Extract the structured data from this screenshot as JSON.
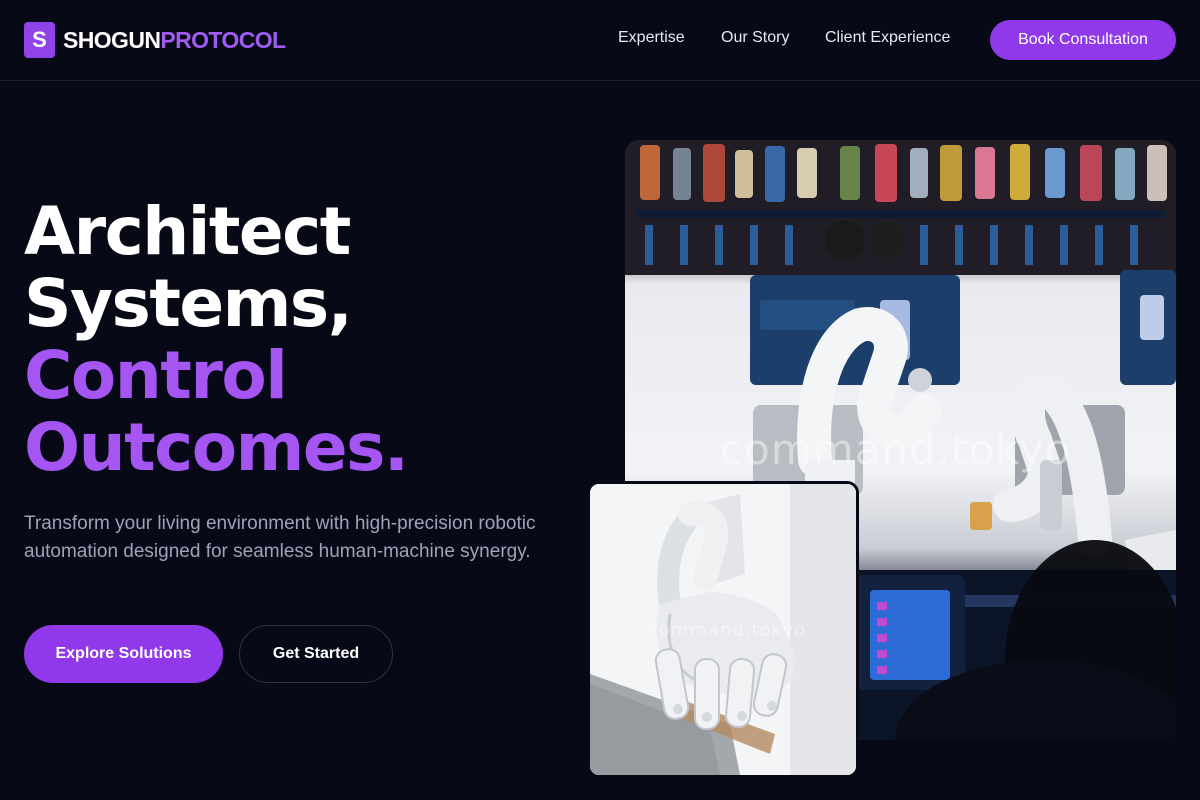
{
  "brand": {
    "mark": "S",
    "name_primary": "SHOGUN",
    "name_accent": "PROTOCOL"
  },
  "nav": {
    "links": [
      "Expertise",
      "Our Story",
      "Client Experience"
    ],
    "cta": "Book Consultation"
  },
  "hero": {
    "headline_line1": "Architect",
    "headline_line2": "Systems,",
    "headline_line3": "Control",
    "headline_line4": "Outcomes.",
    "subtext": "Transform your living environment with high-precision robotic automation designed for seamless human-machine synergy.",
    "primary_button": "Explore Solutions",
    "secondary_button": "Get Started"
  },
  "images": {
    "main_watermark": "command.tokyo",
    "inset_watermark": "command.tokyo"
  },
  "colors": {
    "background": "#070917",
    "accent": "#9039ea",
    "accent_text": "#a555f2",
    "muted_text": "#9ea3b8"
  }
}
